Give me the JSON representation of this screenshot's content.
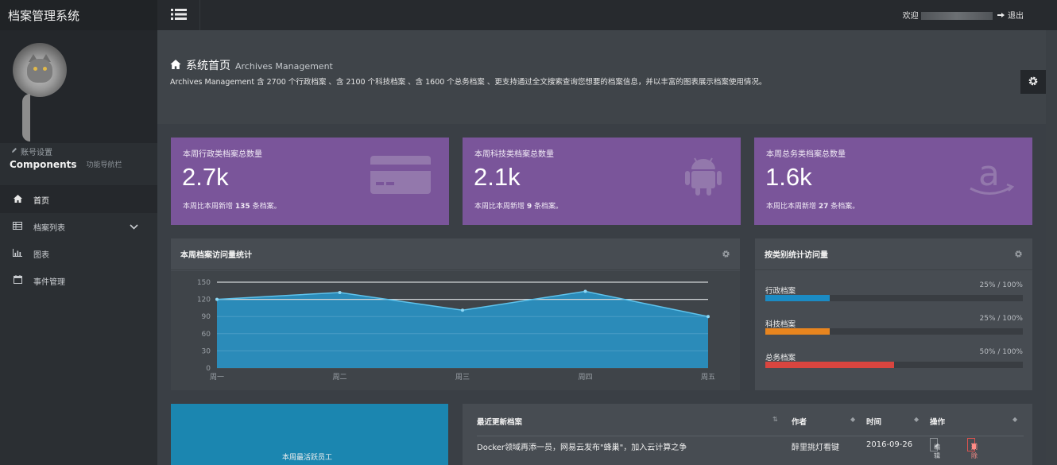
{
  "app": {
    "title": "档案管理系统"
  },
  "sidebar": {
    "account_label": "账号设置",
    "components_title": "Components",
    "components_sub": "功能导航栏",
    "items": [
      {
        "label": "首页",
        "icon": "home-icon",
        "active": true
      },
      {
        "label": "档案列表",
        "icon": "table-icon",
        "active": false,
        "expandable": true
      },
      {
        "label": "图表",
        "icon": "bar-chart-icon",
        "active": false
      },
      {
        "label": "事件管理",
        "icon": "calendar-icon",
        "active": false
      }
    ]
  },
  "topbar": {
    "welcome_prefix": "欢迎",
    "logout_label": "退出"
  },
  "header": {
    "title": "系统首页",
    "title_en": "Archives Management",
    "description": "Archives Management 含 2700 个行政档案 、含 2100 个科技档案 、含 1600 个总务档案 、更支持通过全文搜索查询您想要的档案信息，并以丰富的图表展示档案使用情况。"
  },
  "cards": [
    {
      "label": "本周行政类档案总数量",
      "value": "2.7k",
      "foot_prefix": "本周比本周新增",
      "foot_num": "135",
      "foot_suffix": "条档案。",
      "icon": "credit-card-icon"
    },
    {
      "label": "本周科技类档案总数量",
      "value": "2.1k",
      "foot_prefix": "本周比本周新增",
      "foot_num": "9",
      "foot_suffix": "条档案。",
      "icon": "android-icon"
    },
    {
      "label": "本周总务类档案总数量",
      "value": "1.6k",
      "foot_prefix": "本周比本周新增",
      "foot_num": "27",
      "foot_suffix": "条档案。",
      "icon": "amazon-icon"
    }
  ],
  "visits": {
    "title": "本周档案访问量统计"
  },
  "chart_data": {
    "type": "area",
    "categories": [
      "周一",
      "周二",
      "周三",
      "周四",
      "周五"
    ],
    "values": [
      120,
      132,
      101,
      134,
      90
    ],
    "ylim": [
      0,
      150
    ],
    "yticks": [
      0,
      30,
      60,
      90,
      120,
      150
    ],
    "reference_lines": [
      150,
      120
    ],
    "grid": true,
    "color": "#2a8fc0"
  },
  "categories_panel": {
    "title": "按类别统计访问量",
    "rows": [
      {
        "label": "行政档案",
        "value_text": "25% / 100%",
        "fraction": 0.25,
        "color": "#1b8bc4"
      },
      {
        "label": "科技档案",
        "value_text": "25% / 100%",
        "fraction": 0.25,
        "color": "#e8851f"
      },
      {
        "label": "总务档案",
        "value_text": "50% / 100%",
        "fraction": 0.5,
        "color": "#d9453f"
      }
    ]
  },
  "active_panel": {
    "label": "本周最活跃员工"
  },
  "files": {
    "columns": [
      "最近更新档案",
      "作者",
      "时间",
      "操作"
    ],
    "rows": [
      {
        "title": "Docker领域再添一员，网易云发布\"蜂巢\"，加入云计算之争",
        "author": "醉里挑灯看键",
        "date": "2016-09-26",
        "edit": "编辑",
        "delete": "删除"
      }
    ]
  },
  "colors": {
    "card": "#7a559a",
    "sidebar": "#2b2f33",
    "accent": "#1b86b0"
  }
}
